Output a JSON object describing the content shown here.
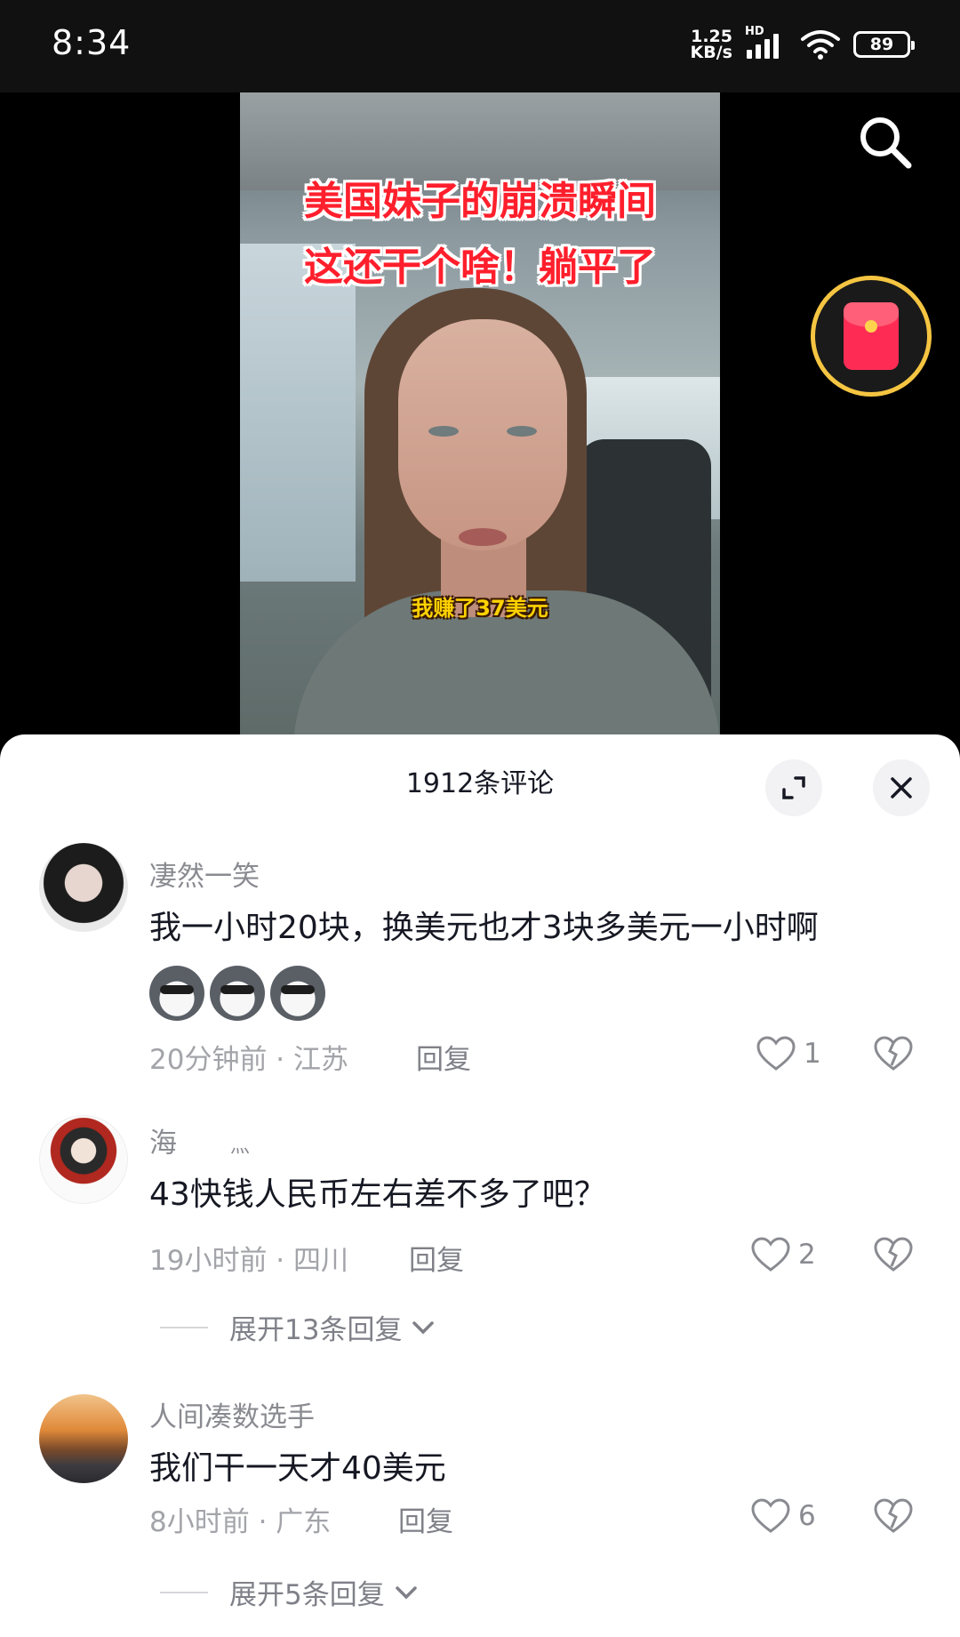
{
  "status_bar": {
    "time": "8:34",
    "net_speed_value": "1.25",
    "net_speed_unit": "KB/s",
    "network_label": "HD",
    "battery": "89"
  },
  "video": {
    "overlay_title_line1": "美国妹子的崩溃瞬间",
    "overlay_title_line2": "这还干个啥！躺平了",
    "subtitle": "我赚了37美元",
    "icons": {
      "search": "search-icon",
      "red_packet": "red-packet-icon"
    }
  },
  "comments_panel": {
    "title": "1912条评论",
    "icons": {
      "expand": "expand-icon",
      "close": "close-icon"
    },
    "comments": [
      {
        "username": "凄然一笑",
        "text": "我一小时20块，换美元也才3块多美元一小时啊",
        "emojis": [
          "dog-emoji",
          "dog-emoji",
          "dog-emoji"
        ],
        "meta": "20分钟前 · 江苏",
        "reply_label": "回复",
        "likes": "1"
      },
      {
        "username": "海",
        "username_suffix": "灬",
        "text": "43快钱人民币左右差不多了吧？",
        "meta": "19小时前 · 四川",
        "reply_label": "回复",
        "likes": "2",
        "expand_replies": "展开13条回复"
      },
      {
        "username": "人间凑数选手",
        "text": "我们干一天才40美元",
        "meta": "8小时前 · 广东",
        "reply_label": "回复",
        "likes": "6",
        "expand_replies": "展开5条回复"
      }
    ]
  },
  "colors": {
    "accent_red": "#fe2c55",
    "ring_gold": "#f5c542",
    "text_primary": "#161823",
    "text_secondary": "#8a8b91"
  }
}
